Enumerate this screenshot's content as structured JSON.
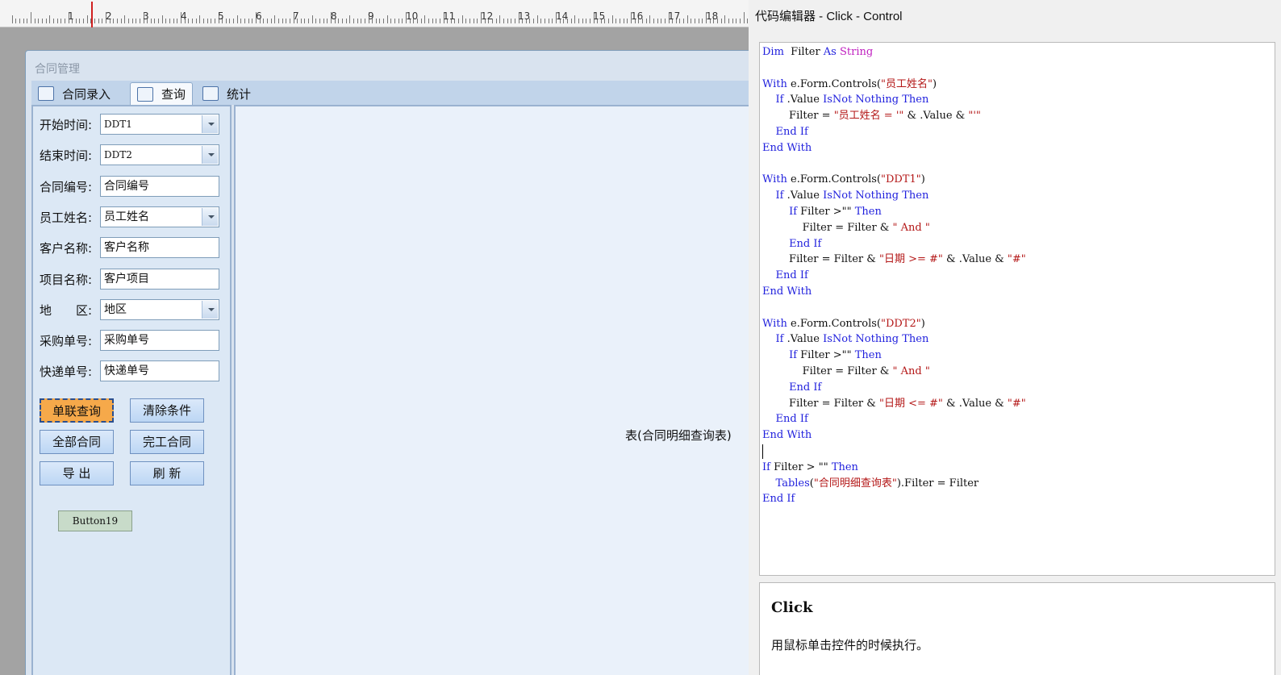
{
  "ruler": {
    "numbers": [
      "1",
      "2",
      "3",
      "4",
      "5",
      "6",
      "7",
      "8",
      "9",
      "10",
      "11",
      "12",
      "13",
      "14",
      "15",
      "16",
      "17",
      "18"
    ]
  },
  "form": {
    "title": "合同管理",
    "tabs": [
      {
        "label": "合同录入",
        "icon": "form-entry-icon"
      },
      {
        "label": "查询",
        "icon": "query-icon"
      },
      {
        "label": "统计",
        "icon": "stats-icon"
      }
    ],
    "fields": [
      {
        "label": "开始时间:",
        "value": "DDT1",
        "dropdown": true
      },
      {
        "label": "结束时间:",
        "value": "DDT2",
        "dropdown": true
      },
      {
        "label": "合同编号:",
        "value": "合同编号",
        "dropdown": false
      },
      {
        "label": "员工姓名:",
        "value": "员工姓名",
        "dropdown": true
      },
      {
        "label": "客户名称:",
        "value": "客户名称",
        "dropdown": false
      },
      {
        "label": "项目名称:",
        "value": "客户项目",
        "dropdown": false
      },
      {
        "label": "地　　区:",
        "value": "地区",
        "dropdown": true
      },
      {
        "label": "采购单号:",
        "value": "采购单号",
        "dropdown": false
      },
      {
        "label": "快递单号:",
        "value": "快递单号",
        "dropdown": false
      }
    ],
    "buttons": {
      "single_query": "单联查询",
      "clear": "清除条件",
      "all_contracts": "全部合同",
      "finished_contracts": "完工合同",
      "export": "导 出",
      "refresh": "刷 新",
      "button19": "Button19"
    },
    "table_label": "表(合同明细查询表)"
  },
  "editor": {
    "title": "代码编辑器 - Click - Control",
    "code_lines": [
      [
        [
          "kw",
          "Dim"
        ],
        [
          "",
          "  Filter "
        ],
        [
          "kw",
          "As"
        ],
        [
          "typ",
          " String"
        ]
      ],
      [],
      [
        [
          "kw",
          "With"
        ],
        [
          "",
          " e.Form.Controls("
        ],
        [
          "str",
          "\"员工姓名\""
        ],
        [
          "",
          ")"
        ]
      ],
      [
        [
          "",
          "    "
        ],
        [
          "kw",
          "If"
        ],
        [
          "",
          " .Value "
        ],
        [
          "kw",
          "IsNot Nothing Then"
        ]
      ],
      [
        [
          "",
          "        Filter = "
        ],
        [
          "str",
          "\"员工姓名 = '\""
        ],
        [
          "",
          " & .Value & "
        ],
        [
          "str",
          "\"'\""
        ]
      ],
      [
        [
          "",
          "    "
        ],
        [
          "kw",
          "End If"
        ]
      ],
      [
        [
          "kw",
          "End With"
        ]
      ],
      [],
      [
        [
          "kw",
          "With"
        ],
        [
          "",
          " e.Form.Controls("
        ],
        [
          "str",
          "\"DDT1\""
        ],
        [
          "",
          ")"
        ]
      ],
      [
        [
          "",
          "    "
        ],
        [
          "kw",
          "If"
        ],
        [
          "",
          " .Value "
        ],
        [
          "kw",
          "IsNot Nothing Then"
        ]
      ],
      [
        [
          "",
          "        "
        ],
        [
          "kw",
          "If"
        ],
        [
          "",
          " Filter >\"\" "
        ],
        [
          "kw",
          "Then"
        ]
      ],
      [
        [
          "",
          "            Filter = Filter & "
        ],
        [
          "str",
          "\" And \""
        ]
      ],
      [
        [
          "",
          "        "
        ],
        [
          "kw",
          "End If"
        ]
      ],
      [
        [
          "",
          "        Filter = Filter & "
        ],
        [
          "str",
          "\"日期 >= #\""
        ],
        [
          "",
          " & .Value & "
        ],
        [
          "str",
          "\"#\""
        ]
      ],
      [
        [
          "",
          "    "
        ],
        [
          "kw",
          "End If"
        ]
      ],
      [
        [
          "kw",
          "End With"
        ]
      ],
      [],
      [
        [
          "kw",
          "With"
        ],
        [
          "",
          " e.Form.Controls("
        ],
        [
          "str",
          "\"DDT2\""
        ],
        [
          "",
          ")"
        ]
      ],
      [
        [
          "",
          "    "
        ],
        [
          "kw",
          "If"
        ],
        [
          "",
          " .Value "
        ],
        [
          "kw",
          "IsNot Nothing Then"
        ]
      ],
      [
        [
          "",
          "        "
        ],
        [
          "kw",
          "If"
        ],
        [
          "",
          " Filter >\"\" "
        ],
        [
          "kw",
          "Then"
        ]
      ],
      [
        [
          "",
          "            Filter = Filter & "
        ],
        [
          "str",
          "\" And \""
        ]
      ],
      [
        [
          "",
          "        "
        ],
        [
          "kw",
          "End If"
        ]
      ],
      [
        [
          "",
          "        Filter = Filter & "
        ],
        [
          "str",
          "\"日期 <= #\""
        ],
        [
          "",
          " & .Value & "
        ],
        [
          "str",
          "\"#\""
        ]
      ],
      [
        [
          "",
          "    "
        ],
        [
          "kw",
          "End If"
        ]
      ],
      [
        [
          "kw",
          "End With"
        ]
      ],
      [],
      [
        [
          "kw",
          "If"
        ],
        [
          "",
          " Filter > \"\" "
        ],
        [
          "kw",
          "Then"
        ]
      ],
      [
        [
          "",
          "    "
        ],
        [
          "kw",
          "Tables"
        ],
        [
          "",
          "("
        ],
        [
          "str",
          "\"合同明细查询表\""
        ],
        [
          "",
          ").Filter = Filter"
        ]
      ],
      [
        [
          "kw",
          "End If"
        ]
      ]
    ],
    "help_title": "Click",
    "help_text": "用鼠标单击控件的时候执行。"
  }
}
